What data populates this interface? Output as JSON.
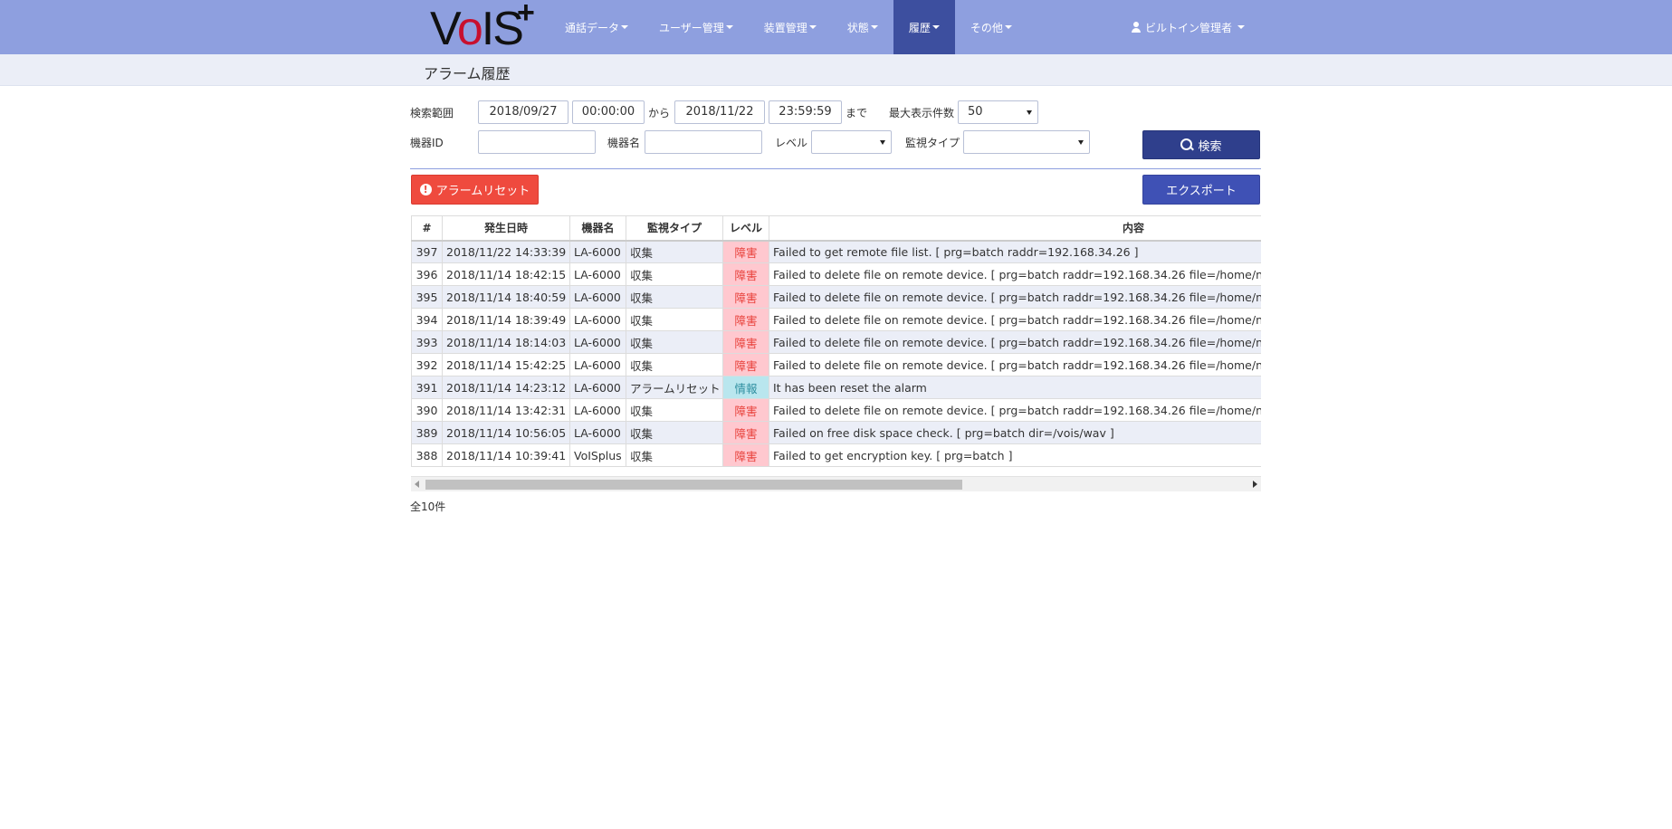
{
  "logo": {
    "text_v": "V",
    "text_o": "o",
    "text_rest": "IS",
    "plus": "+"
  },
  "nav": {
    "items": [
      {
        "label": "通話データ"
      },
      {
        "label": "ユーザー管理"
      },
      {
        "label": "装置管理"
      },
      {
        "label": "状態"
      },
      {
        "label": "履歴",
        "active": true
      },
      {
        "label": "その他"
      }
    ],
    "user": "ビルトイン管理者",
    "active_color": "#3d4f9f",
    "bar_color": "#8e9fdf"
  },
  "page": {
    "title": "アラーム履歴"
  },
  "search": {
    "range_label": "検索範囲",
    "from_date": "2018/09/27",
    "from_time": "00:00:00",
    "from_suffix": "から",
    "to_date": "2018/11/22",
    "to_time": "23:59:59",
    "to_suffix": "まで",
    "max_label": "最大表示件数",
    "max_value": "50",
    "device_id_label": "機器ID",
    "device_id_value": "",
    "device_name_label": "機器名",
    "device_name_value": "",
    "level_label": "レベル",
    "level_value": "",
    "monitor_type_label": "監視タイプ",
    "monitor_type_value": "",
    "search_button": "検索"
  },
  "actions": {
    "reset_button": "アラームリセット",
    "export_button": "エクスポート"
  },
  "table": {
    "headers": [
      "#",
      "発生日時",
      "機器名",
      "監視タイプ",
      "レベル",
      "内容"
    ],
    "rows": [
      [
        "397",
        "2018/11/22 14:33:39",
        "LA-6000",
        "収集",
        "障害",
        "Failed to get remote file list. [ prg=batch raddr=192.168.34.26 ]"
      ],
      [
        "396",
        "2018/11/14 18:42:15",
        "LA-6000",
        "収集",
        "障害",
        "Failed to delete file on remote device. [ prg=batch raddr=192.168.34.26 file=/home/nextge"
      ],
      [
        "395",
        "2018/11/14 18:40:59",
        "LA-6000",
        "収集",
        "障害",
        "Failed to delete file on remote device. [ prg=batch raddr=192.168.34.26 file=/home/nextge"
      ],
      [
        "394",
        "2018/11/14 18:39:49",
        "LA-6000",
        "収集",
        "障害",
        "Failed to delete file on remote device. [ prg=batch raddr=192.168.34.26 file=/home/nextge"
      ],
      [
        "393",
        "2018/11/14 18:14:03",
        "LA-6000",
        "収集",
        "障害",
        "Failed to delete file on remote device. [ prg=batch raddr=192.168.34.26 file=/home/nextge"
      ],
      [
        "392",
        "2018/11/14 15:42:25",
        "LA-6000",
        "収集",
        "障害",
        "Failed to delete file on remote device. [ prg=batch raddr=192.168.34.26 file=/home/nextge"
      ],
      [
        "391",
        "2018/11/14 14:23:12",
        "LA-6000",
        "アラームリセット",
        "情報",
        "It has been reset the alarm"
      ],
      [
        "390",
        "2018/11/14 13:42:31",
        "LA-6000",
        "収集",
        "障害",
        "Failed to delete file on remote device. [ prg=batch raddr=192.168.34.26 file=/home/nextge"
      ],
      [
        "389",
        "2018/11/14 10:56:05",
        "LA-6000",
        "収集",
        "障害",
        "Failed on free disk space check. [ prg=batch dir=/vois/wav ]"
      ],
      [
        "388",
        "2018/11/14 10:39:41",
        "VoISplus",
        "収集",
        "障害",
        "Failed to get encryption key. [ prg=batch ]"
      ]
    ],
    "level_colors": {
      "障害": "#ffc8cf",
      "情報": "#b9e6ee"
    }
  },
  "footer": {
    "total": "全10件"
  }
}
